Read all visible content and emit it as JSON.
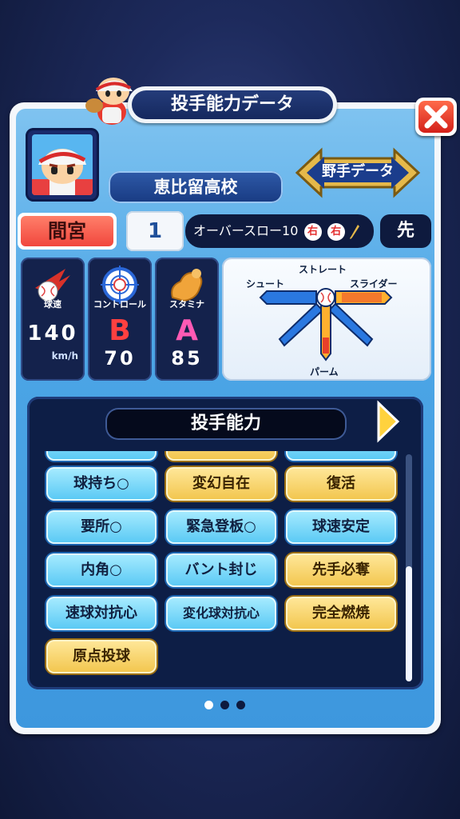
{
  "header": {
    "title": "投手能力データ"
  },
  "close": {
    "icon": "close-icon"
  },
  "player": {
    "school": "恵比留高校",
    "name": "間宮",
    "number": "1",
    "form": "オーバースロー10",
    "throws": "右",
    "bats": "右",
    "role": "先"
  },
  "fielder_button": {
    "label": "野手データ"
  },
  "stats": {
    "speed": {
      "label": "球速",
      "value": "140",
      "unit": "km/h"
    },
    "control": {
      "label": "コントロール",
      "grade": "B",
      "value": "70",
      "grade_color": "#ff4040"
    },
    "stamina": {
      "label": "スタミナ",
      "grade": "A",
      "value": "85",
      "grade_color": "#ff5ab4"
    }
  },
  "pitches": {
    "straight": "ストレート",
    "shoot": "シュート",
    "slider": "スライダー",
    "palm": "パーム"
  },
  "abilities": {
    "title": "投手能力",
    "items": [
      {
        "label": "球持ち○",
        "style": "blue"
      },
      {
        "label": "変幻自在",
        "style": "gold"
      },
      {
        "label": "復活",
        "style": "gold"
      },
      {
        "label": "要所○",
        "style": "blue"
      },
      {
        "label": "緊急登板○",
        "style": "blue"
      },
      {
        "label": "球速安定",
        "style": "blue"
      },
      {
        "label": "内角○",
        "style": "blue"
      },
      {
        "label": "バント封じ",
        "style": "blue"
      },
      {
        "label": "先手必奪",
        "style": "gold"
      },
      {
        "label": "速球対抗心",
        "style": "blue"
      },
      {
        "label": "変化球対抗心",
        "style": "blue"
      },
      {
        "label": "完全燃焼",
        "style": "gold"
      },
      {
        "label": "原点投球",
        "style": "gold"
      }
    ]
  },
  "pagination": {
    "current": 1,
    "total": 3
  }
}
